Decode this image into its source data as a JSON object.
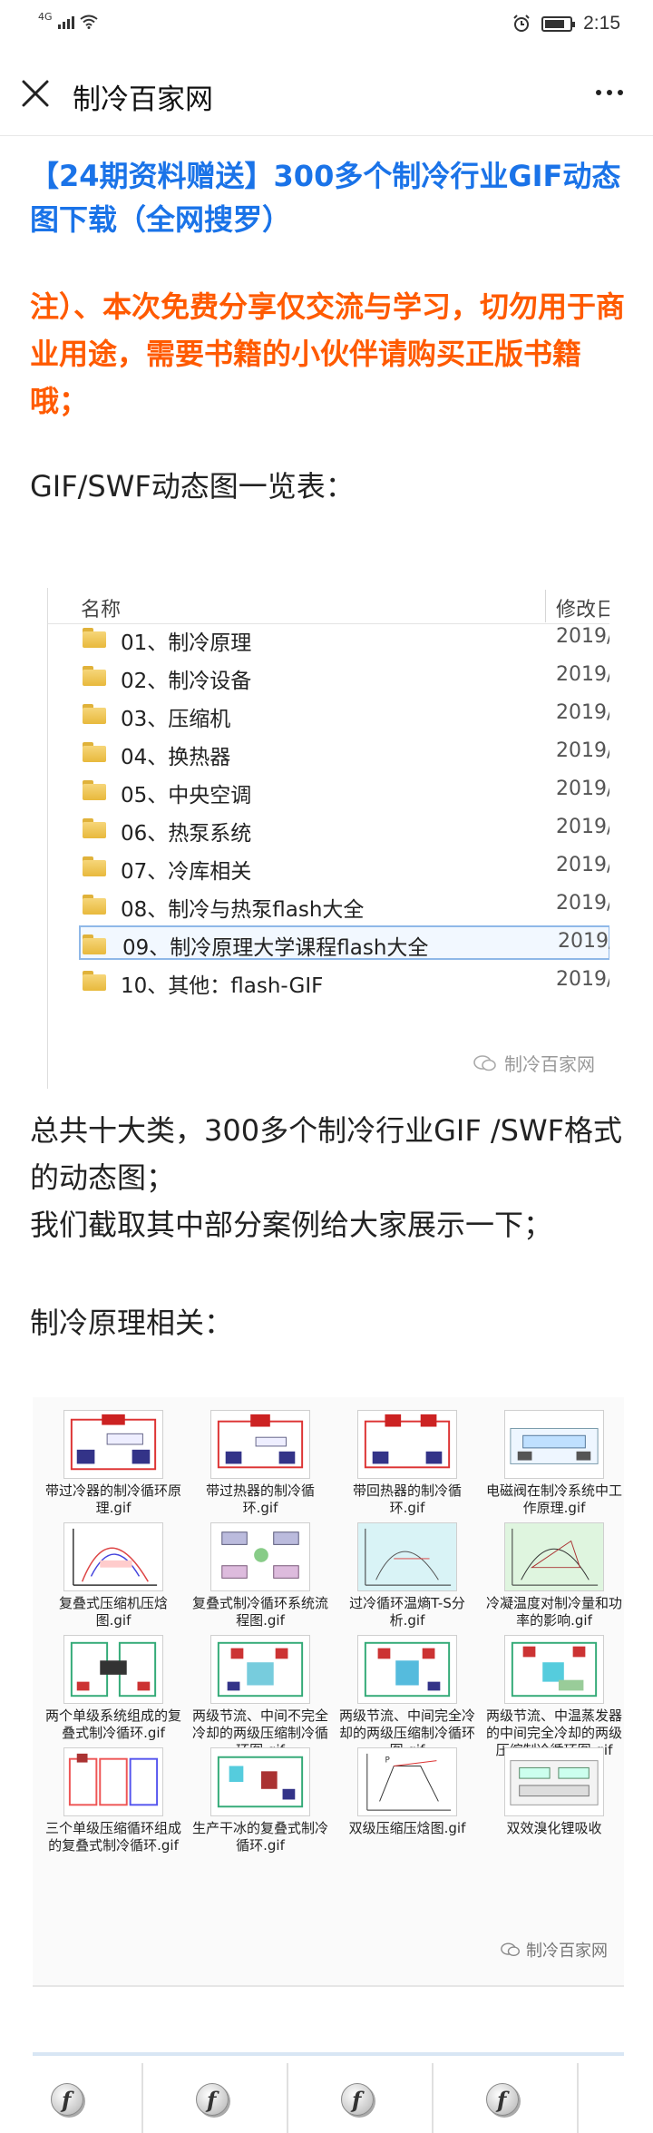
{
  "status": {
    "network": "4G",
    "time": "2:15"
  },
  "nav": {
    "title": "制冷百家网"
  },
  "article": {
    "title": "【24期资料赠送】300多个制冷行业GIF动态图下载（全网搜罗）",
    "notice": "注）、本次免费分享仅交流与学习，切勿用于商业用途，需要书籍的小伙伴请购买正版书籍哦；",
    "gif_list_heading": "GIF/SWF动态图一览表：",
    "summary_1": "总共十大类，300多个制冷行业GIF /SWF格式的动态图；",
    "summary_2": "我们截取其中部分案例给大家展示一下；",
    "category_heading": "制冷原理相关："
  },
  "explorer": {
    "col_name": "名称",
    "col_date": "修改日",
    "folders": [
      {
        "name": "01、制冷原理",
        "date": "2019/"
      },
      {
        "name": "02、制冷设备",
        "date": "2019/"
      },
      {
        "name": "03、压缩机",
        "date": "2019/"
      },
      {
        "name": "04、换热器",
        "date": "2019/"
      },
      {
        "name": "05、中央空调",
        "date": "2019/"
      },
      {
        "name": "06、热泵系统",
        "date": "2019/"
      },
      {
        "name": "07、冷库相关",
        "date": "2019/"
      },
      {
        "name": "08、制冷与热泵flash大全",
        "date": "2019/"
      },
      {
        "name": "09、制冷原理大学课程flash大全",
        "date": "2019/"
      },
      {
        "name": "10、其他：flash-GIF",
        "date": "2019/"
      }
    ],
    "watermark": "制冷百家网"
  },
  "gif_files": [
    {
      "label": "带过冷器的制冷循环原理.gif"
    },
    {
      "label": "带过热器的制冷循环.gif"
    },
    {
      "label": "带回热器的制冷循环.gif"
    },
    {
      "label": "电磁阀在制冷系统中工作原理.gif"
    },
    {
      "label": "复叠式压缩机压焓图.gif"
    },
    {
      "label": "复叠式制冷循环系统流程图.gif"
    },
    {
      "label": "过冷循环温熵T-S分析.gif"
    },
    {
      "label": "冷凝温度对制冷量和功率的影响.gif"
    },
    {
      "label": "两个单级系统组成的复叠式制冷循环.gif"
    },
    {
      "label": "两级节流、中间不完全冷却的两级压缩制冷循环图.gif"
    },
    {
      "label": "两级节流、中间完全冷却的两级压缩制冷循环图.gif"
    },
    {
      "label": "两级节流、中温蒸发器的中间完全冷却的两级压缩制冷循环图.gif"
    },
    {
      "label": "三个单级压缩循环组成的复叠式制冷循环.gif"
    },
    {
      "label": "生产干冰的复叠式制冷循环.gif"
    },
    {
      "label": "双级压缩压焓图.gif"
    },
    {
      "label": "双效溴化锂吸收"
    }
  ],
  "grid_watermark": "制冷百家网",
  "colors": {
    "title_blue": "#1a73e8",
    "notice_orange": "#ff5a00"
  }
}
